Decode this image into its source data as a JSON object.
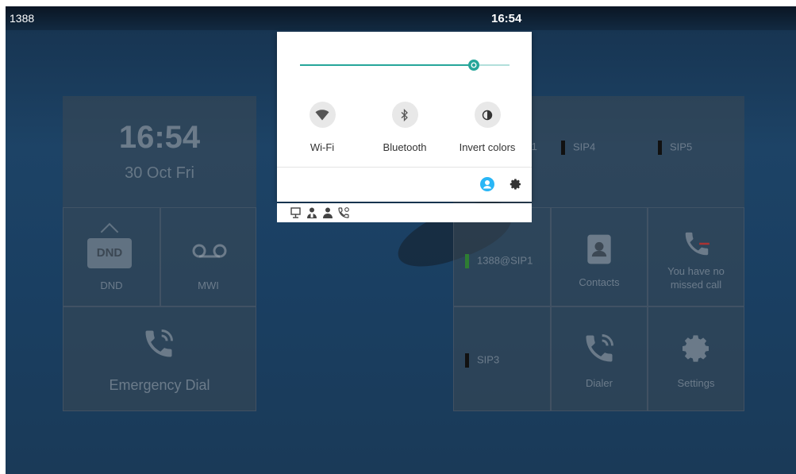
{
  "status_bar": {
    "extension": "1388",
    "clock": "16:54"
  },
  "home": {
    "clock": "16:54",
    "date": "30 Oct Fri",
    "tiles": {
      "dnd_sign": "DND",
      "dnd": "DND",
      "mwi": "MWI",
      "emergency": "Emergency Dial",
      "contacts": "Contacts",
      "missed_line1": "You have no",
      "missed_line2": "missed call",
      "dialer": "Dialer",
      "settings": "Settings"
    },
    "sip": {
      "sip1_partial": "P1",
      "sip4": "SIP4",
      "sip5": "SIP5",
      "account": "1388@SIP1",
      "sip3": "SIP3"
    }
  },
  "quick_settings": {
    "brightness": 0.83,
    "toggles": [
      {
        "label": "Wi-Fi",
        "icon": "wifi-icon"
      },
      {
        "label": "Bluetooth",
        "icon": "bluetooth-icon"
      },
      {
        "label": "Invert colors",
        "icon": "invert-colors-icon"
      }
    ],
    "accent": "#26a69a",
    "user_icon_color": "#29b6f6"
  },
  "notification_icons": [
    "monitor-icon",
    "contact-icon",
    "person-icon",
    "missed-call-icon"
  ]
}
